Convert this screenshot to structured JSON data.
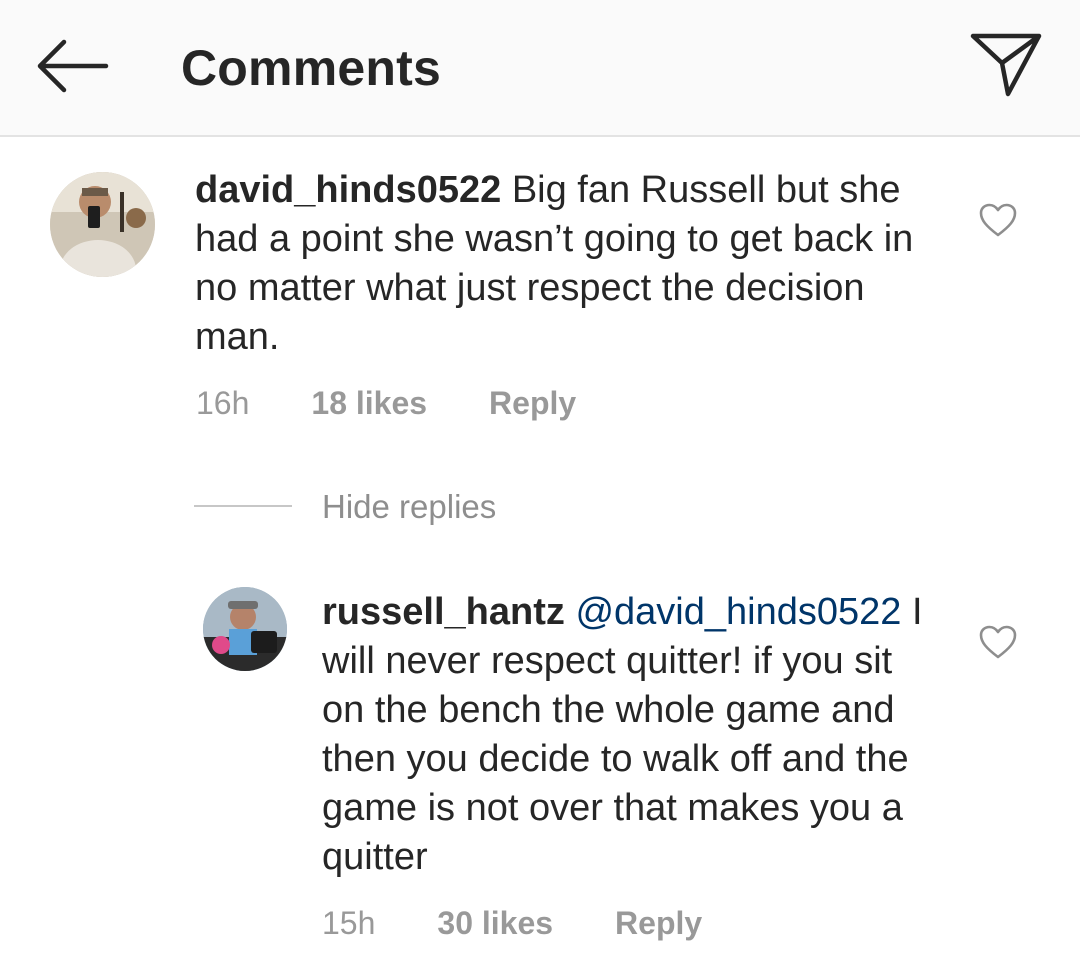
{
  "header": {
    "title": "Comments",
    "back_icon": "arrow-left-icon",
    "share_icon": "paper-plane-icon"
  },
  "comments": [
    {
      "username": "david_hinds0522",
      "text": "Big fan Russell but she had a point she wasn’t going to get back in no matter what just respect the decision man.",
      "time": "16h",
      "likes": "18 likes",
      "reply_label": "Reply"
    }
  ],
  "replies_toggle": "Hide replies",
  "replies": [
    {
      "username": "russell_hantz",
      "mention": "@david_hinds0522",
      "text": "I will never respect quitter! if you sit on the bench the whole game and then you decide to walk off and the game is not over that makes you a quitter",
      "time": "15h",
      "likes": "30 likes",
      "reply_label": "Reply"
    }
  ],
  "colors": {
    "header_bg": "#fafafa",
    "text": "#262626",
    "muted": "#999999",
    "mention": "#003569",
    "divider": "#e3e3e3"
  }
}
